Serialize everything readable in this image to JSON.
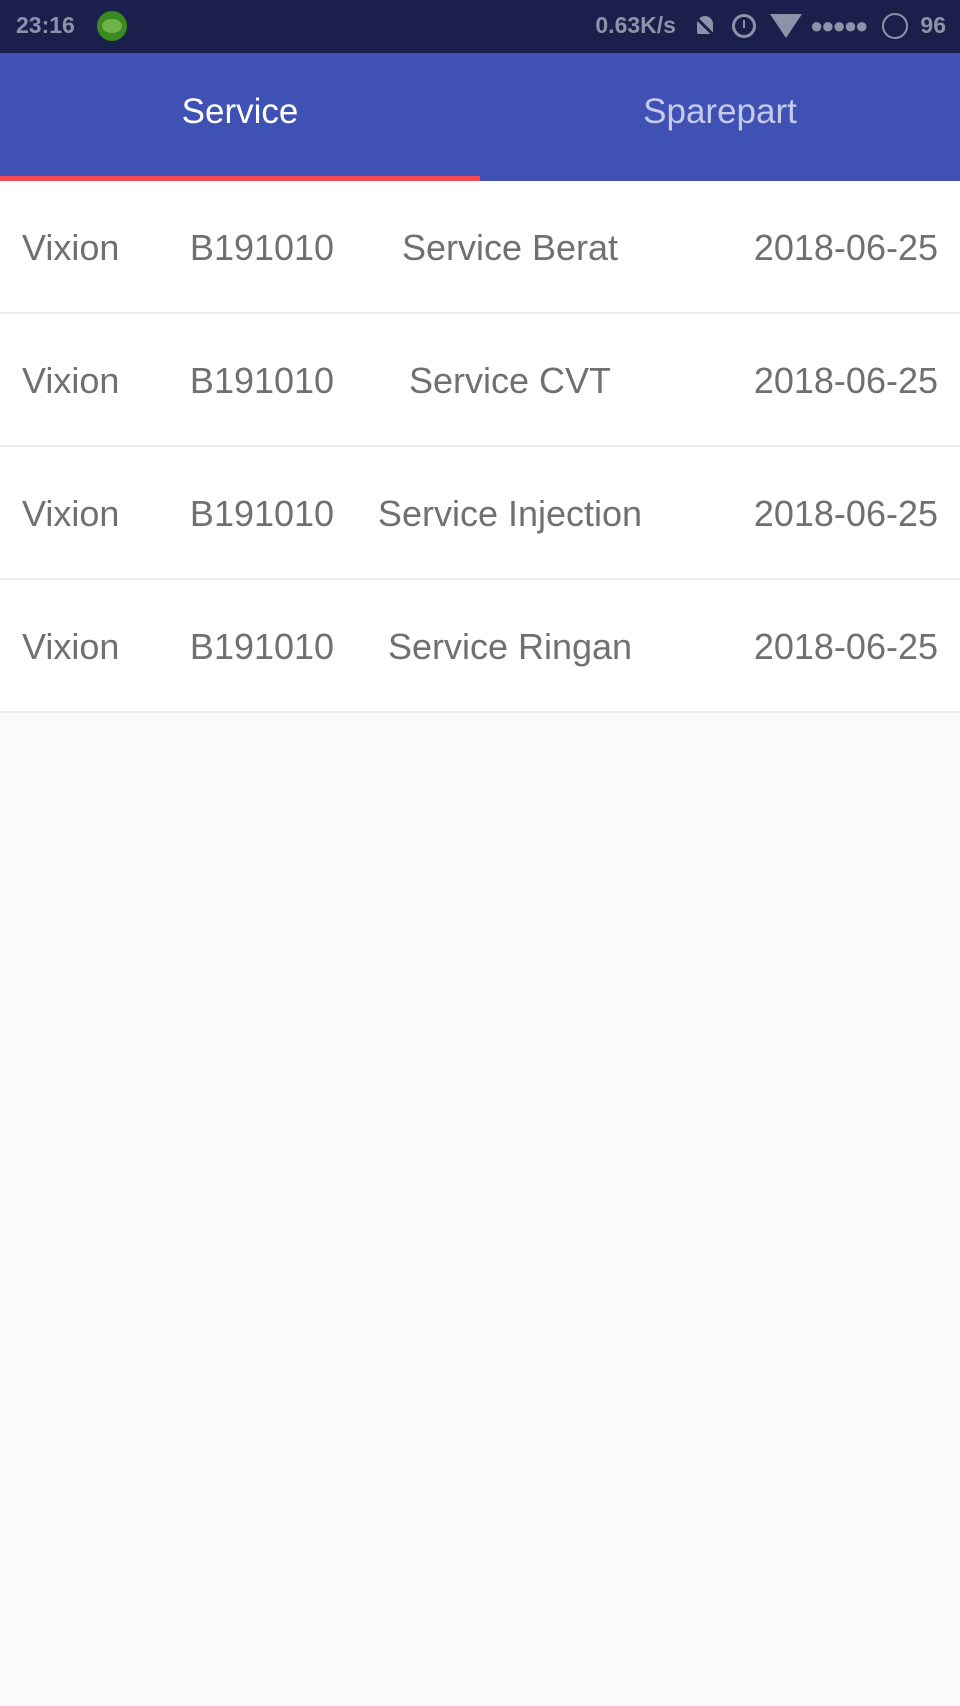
{
  "status_bar": {
    "time": "23:16",
    "net_speed": "0.63K/s",
    "signal": "●●●●●",
    "battery": "96",
    "icons": [
      "line-app-icon",
      "mute-icon",
      "alarm-icon",
      "wifi-icon",
      "battery-icon"
    ]
  },
  "tabs": [
    {
      "label": "Service",
      "active": true
    },
    {
      "label": "Sparepart",
      "active": false
    }
  ],
  "colors": {
    "primary": "#3f51b5",
    "indicator": "#f44a56",
    "status_bar": "#1a1f4c"
  },
  "rows": [
    {
      "model": "Vixion",
      "code": "B191010",
      "service": "Service Berat",
      "date": "2018-06-25"
    },
    {
      "model": "Vixion",
      "code": "B191010",
      "service": "Service CVT",
      "date": "2018-06-25"
    },
    {
      "model": "Vixion",
      "code": "B191010",
      "service": "Service Injection",
      "date": "2018-06-25"
    },
    {
      "model": "Vixion",
      "code": "B191010",
      "service": "Service Ringan",
      "date": "2018-06-25"
    }
  ]
}
